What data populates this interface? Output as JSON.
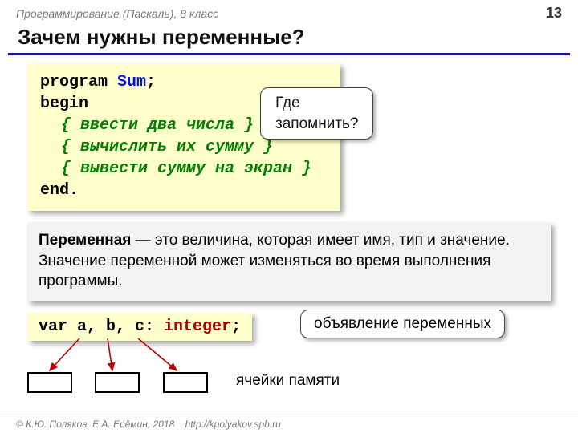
{
  "header": {
    "course": "Программирование (Паскаль), 8 класс",
    "page": "13"
  },
  "title": "Зачем нужны переменные?",
  "code": {
    "l1a": "program",
    "l1b": "Sum",
    "l1c": ";",
    "l2": "begin",
    "l3": "{ ввести два числа }",
    "l4": "{ вычислить их сумму }",
    "l5": "{ вывести сумму на экран }",
    "l6": "end."
  },
  "callout": "Где запомнить?",
  "definition": {
    "term": "Переменная",
    "rest": " — это величина, которая имеет имя, тип и значение. Значение переменной может изменяться во время выполнения программы."
  },
  "var_decl": {
    "kw": "var",
    "names": " a, b, c",
    "colon": ": ",
    "type": "integer",
    "semi": ";"
  },
  "decl_label": "объявление переменных",
  "mem_label": "ячейки памяти",
  "footer": {
    "copyright": "© К.Ю. Поляков, Е.А. Ерёмин, 2018",
    "url": "http://kpolyakov.spb.ru"
  }
}
